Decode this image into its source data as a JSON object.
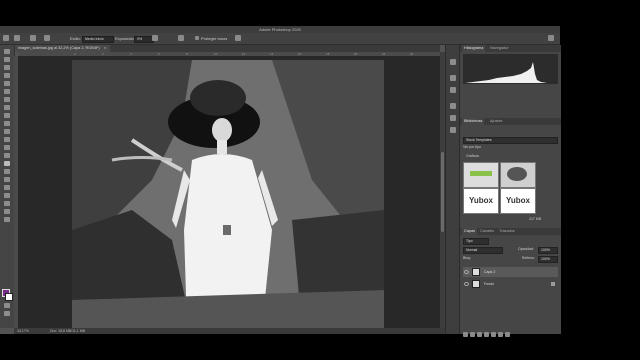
{
  "app": {
    "title": "Adobe Photoshop 2020",
    "accent": "#1473e6"
  },
  "options_bar": {
    "label_style": "Estilo:",
    "style_value": "Medio Inicio",
    "label_exposure": "Exposición:",
    "exposure_value": "0%",
    "protect_tones_label": "Proteger tonos"
  },
  "document_tab": {
    "label": "imagen_sobrinas.jpg al 32,2% (Capa 2, RGB/8*)",
    "close_glyph": "×"
  },
  "status_bar": {
    "zoom": "33,17%",
    "doc_info": "Doc: 18,8 MB/11,1 MB"
  },
  "panels": {
    "histogram": {
      "tabs": [
        "Histograma",
        "Navegador"
      ]
    },
    "libraries": {
      "tabs": [
        "Bibliotecas",
        "Ajustes"
      ],
      "library_select": "Stock Templates",
      "filter_label": "Ver por tipo",
      "section_label": "Gráficos",
      "items": [
        {
          "kind": "logo",
          "text": ""
        },
        {
          "kind": "shape",
          "text": ""
        },
        {
          "kind": "logo",
          "text": "Yubox"
        },
        {
          "kind": "logo",
          "text": "Yubox"
        }
      ],
      "size_info": "217 MB"
    },
    "layers": {
      "tabs": [
        "Capas",
        "Canales",
        "Trazados"
      ],
      "kind_filter": "Tipo",
      "blend_mode": "Normal",
      "opacity_label": "Opacidad:",
      "opacity_value": "100%",
      "lock_label": "Bloq:",
      "fill_label": "Relleno:",
      "fill_value": "100%",
      "rows": [
        {
          "name": "Capa 2",
          "selected": true
        },
        {
          "name": "Fondo",
          "selected": false
        }
      ]
    }
  },
  "ruler_ticks": [
    "0",
    "2",
    "4",
    "6",
    "8",
    "10",
    "12",
    "14",
    "16",
    "18",
    "20",
    "22",
    "24",
    "26"
  ]
}
